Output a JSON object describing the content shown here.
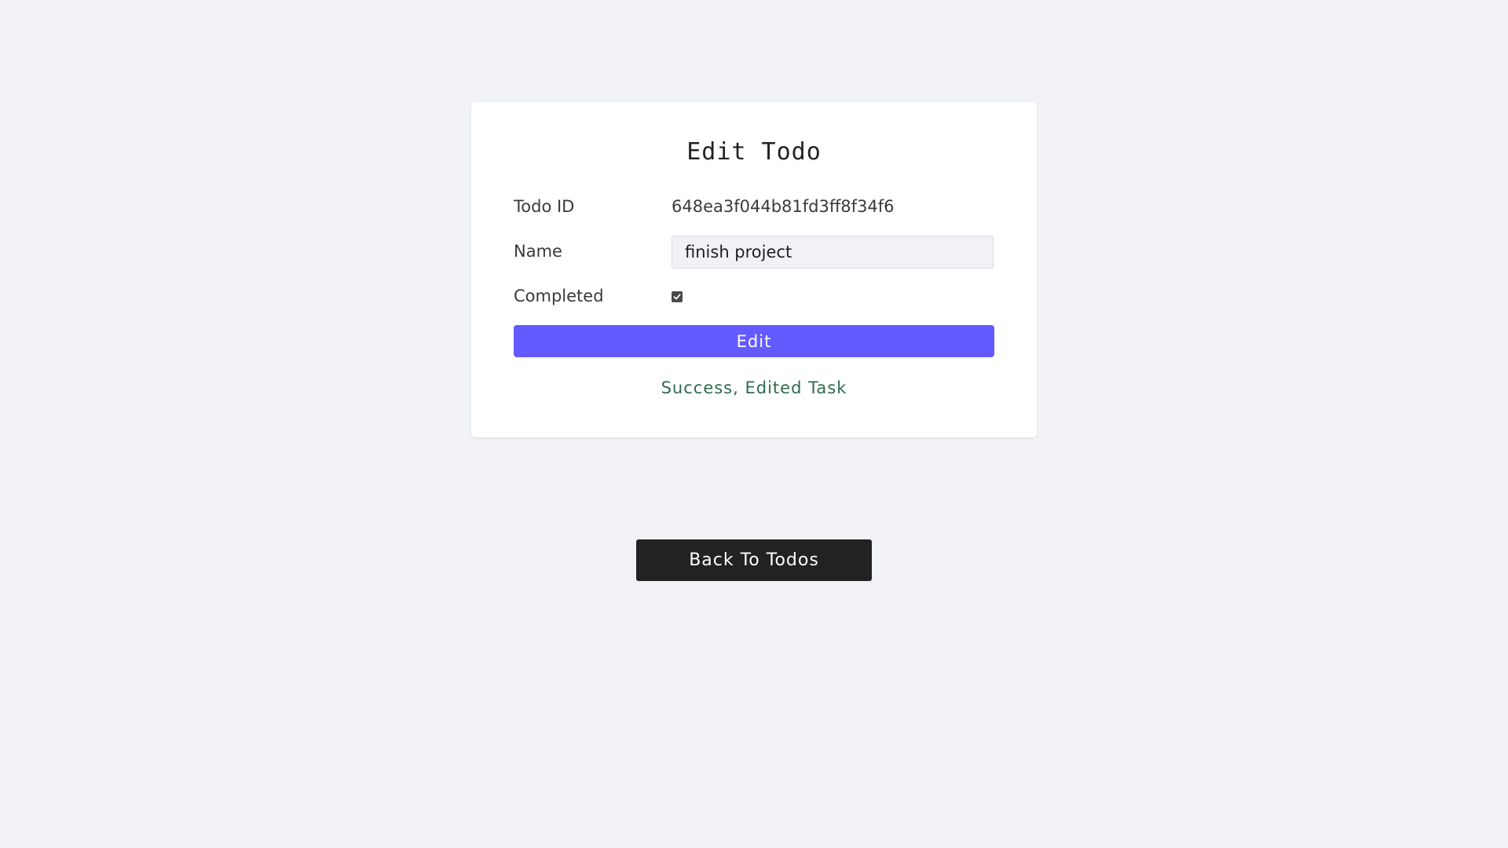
{
  "card": {
    "title": "Edit Todo",
    "todo_id_label": "Todo ID",
    "todo_id_value": "648ea3f044b81fd3ff8f34f6",
    "name_label": "Name",
    "name_value": "finish project",
    "completed_label": "Completed",
    "completed_checked": true,
    "edit_label": "Edit",
    "status_message": "Success, Edited Task"
  },
  "back_button_label": "Back To Todos",
  "colors": {
    "background": "#f2f3f7",
    "accent": "#635bff",
    "success": "#2e6b4f",
    "dark_button": "#222222"
  },
  "icons": {
    "checkbox": "checkmark-icon"
  }
}
